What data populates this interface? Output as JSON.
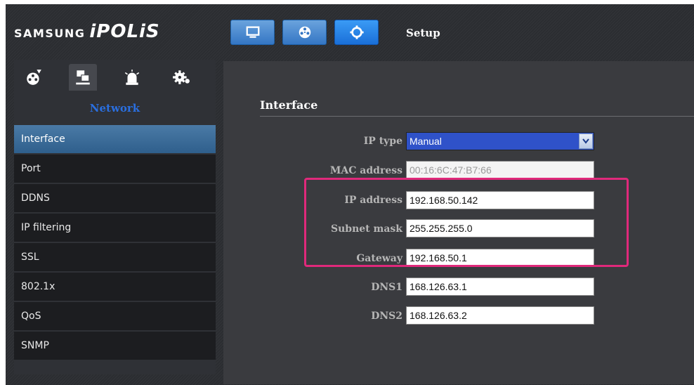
{
  "header": {
    "brand": "SAMSUNG",
    "product": "iPOLiS",
    "buttons": [
      {
        "name": "monitor-icon",
        "active": false
      },
      {
        "name": "reel-icon",
        "active": false
      },
      {
        "name": "gear-icon",
        "active": true
      }
    ],
    "setup_label": "Setup"
  },
  "sidebar": {
    "categories": [
      "video-icon",
      "network-icon",
      "alarm-icon",
      "system-icon"
    ],
    "selected_category": "network-icon",
    "title": "Network",
    "items": [
      {
        "label": "Interface",
        "active": true
      },
      {
        "label": "Port",
        "active": false
      },
      {
        "label": "DDNS",
        "active": false
      },
      {
        "label": "IP filtering",
        "active": false
      },
      {
        "label": "SSL",
        "active": false
      },
      {
        "label": "802.1x",
        "active": false
      },
      {
        "label": "QoS",
        "active": false
      },
      {
        "label": "SNMP",
        "active": false
      }
    ]
  },
  "main": {
    "section_title": "Interface",
    "fields": [
      {
        "label": "IP type",
        "value": "Manual",
        "type": "select"
      },
      {
        "label": "MAC address",
        "value": "00:16:6C:47:B7:66",
        "type": "readonly"
      },
      {
        "label": "IP address",
        "value": "192.168.50.142",
        "type": "input"
      },
      {
        "label": "Subnet mask",
        "value": "255.255.255.0",
        "type": "input"
      },
      {
        "label": "Gateway",
        "value": "192.168.50.1",
        "type": "input"
      },
      {
        "label": "DNS1",
        "value": "168.126.63.1",
        "type": "input"
      },
      {
        "label": "DNS2",
        "value": "168.126.63.2",
        "type": "input"
      }
    ]
  },
  "colors": {
    "highlight": "#e0297b",
    "accent_blue": "#2a6fe0",
    "select_bg": "#2f52c9"
  }
}
